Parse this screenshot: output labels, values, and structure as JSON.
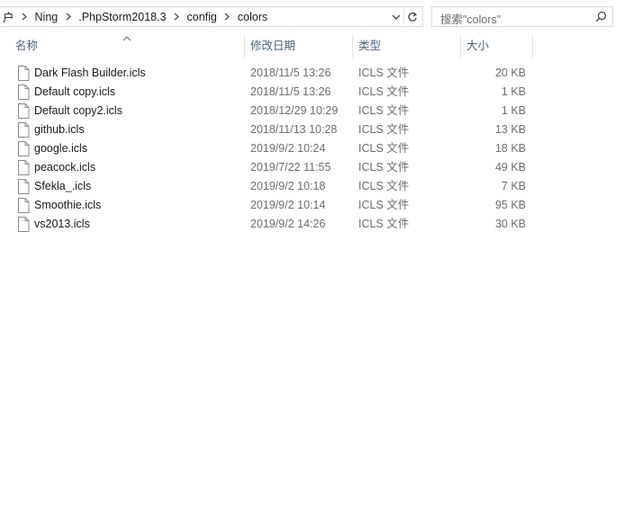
{
  "address_bar": {
    "crumbs": [
      "户",
      "Ning",
      ".PhpStorm2018.3",
      "config",
      "colors"
    ],
    "dropdown_icon": "chevron-down-icon",
    "refresh_icon": "refresh-icon"
  },
  "search": {
    "placeholder": "搜索\"colors\"",
    "icon": "search-icon"
  },
  "columns": {
    "name": "名称",
    "date": "修改日期",
    "type": "类型",
    "size": "大小"
  },
  "files": [
    {
      "name": "Dark Flash Builder.icls",
      "date": "2018/11/5 13:26",
      "type": "ICLS 文件",
      "size": "20 KB"
    },
    {
      "name": "Default copy.icls",
      "date": "2018/11/5 13:26",
      "type": "ICLS 文件",
      "size": "1 KB"
    },
    {
      "name": "Default copy2.icls",
      "date": "2018/12/29 10:29",
      "type": "ICLS 文件",
      "size": "1 KB"
    },
    {
      "name": "github.icls",
      "date": "2018/11/13 10:28",
      "type": "ICLS 文件",
      "size": "13 KB"
    },
    {
      "name": "google.icls",
      "date": "2019/9/2 10:24",
      "type": "ICLS 文件",
      "size": "18 KB"
    },
    {
      "name": "peacock.icls",
      "date": "2019/7/22 11:55",
      "type": "ICLS 文件",
      "size": "49 KB"
    },
    {
      "name": "Sfekla_.icls",
      "date": "2019/9/2 10:18",
      "type": "ICLS 文件",
      "size": "7 KB"
    },
    {
      "name": "Smoothie.icls",
      "date": "2019/9/2 10:14",
      "type": "ICLS 文件",
      "size": "95 KB"
    },
    {
      "name": "vs2013.icls",
      "date": "2019/9/2 14:26",
      "type": "ICLS 文件",
      "size": "30 KB"
    }
  ],
  "colors": {
    "header_text": "#4d6082",
    "secondary_text": "#6d6d6d",
    "border": "#d9d9d9"
  }
}
